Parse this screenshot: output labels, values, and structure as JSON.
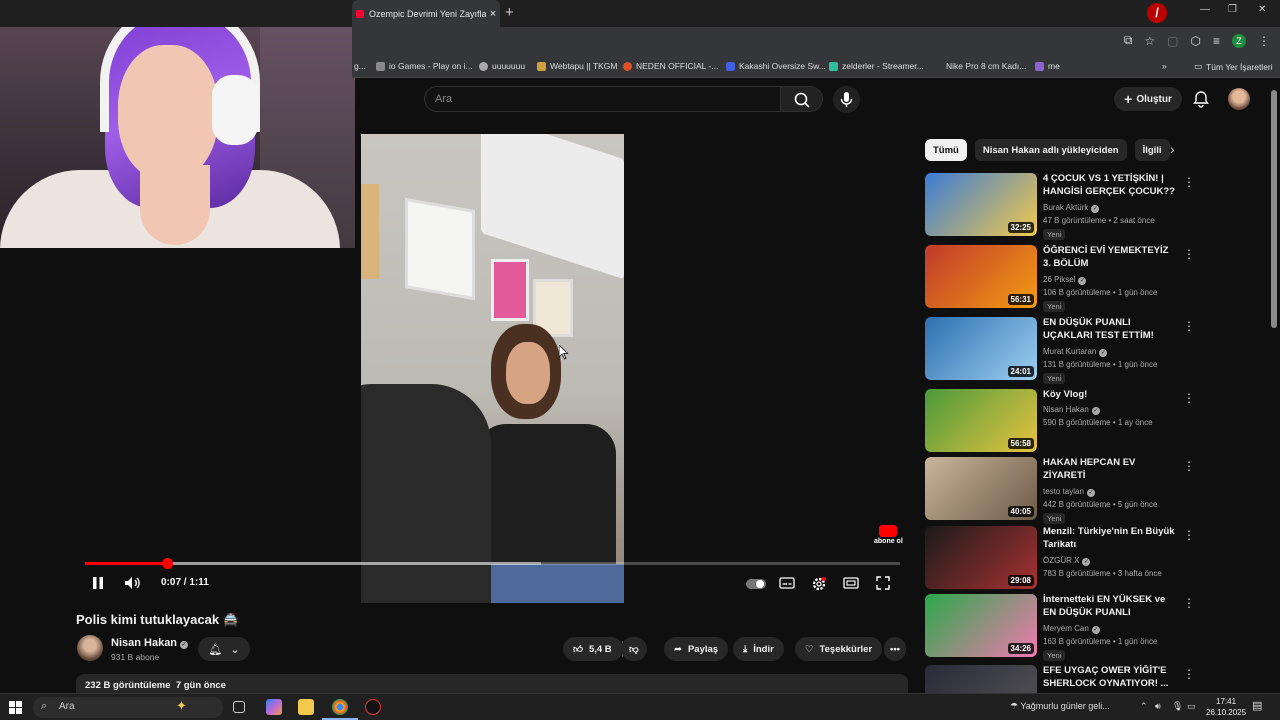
{
  "browser": {
    "tab_title": "Ozempic Devrimi Yeni Zayıflam",
    "tab_close": "×",
    "new_tab": "+",
    "bookmarks": [
      {
        "label": "g...",
        "color": ""
      },
      {
        "label": "io Games - Play on i...",
        "color": "#888888"
      },
      {
        "label": "uuuuuuu",
        "color": "#aaaaaa"
      },
      {
        "label": "Webtapu || TKGM",
        "color": "#d0a040"
      },
      {
        "label": "NEDEN OFFICIAL -...",
        "color": "#e05020"
      },
      {
        "label": "Kakashi Oversize Sw...",
        "color": "#4060e0"
      },
      {
        "label": "zelderler - Streamer...",
        "color": "#30c0a0"
      },
      {
        "label": "Nike Pro 8 cm Kadı...",
        "color": ""
      },
      {
        "label": "me",
        "color": "#9060d0"
      }
    ],
    "all_bookmarks": "Tüm Yer İşaretleri",
    "profile_initial": "Z"
  },
  "youtube": {
    "search_placeholder": "Ara",
    "create_label": "Oluştur",
    "player": {
      "current_time": "0:07 / 1:11",
      "progress": 0.1,
      "buffered": 0.56,
      "subscribe_overlay": "abone ol"
    },
    "video": {
      "title": "Polis kimi tutuklayacak 🚔",
      "channel": "Nisan Hakan",
      "subscribers": "931 B abone",
      "likes": "5,4 B",
      "share": "Paylaş",
      "download": "İndir",
      "thanks": "Teşekkürler",
      "views": "232 B görüntüleme",
      "date": "7 gün önce"
    },
    "chips": [
      "Tümü",
      "Nisan Hakan adlı yükleyiciden",
      "İlgili"
    ],
    "recommendations": [
      {
        "title": "4 ÇOCUK VS 1 YETİŞKİN! | HANGİSİ GERÇEK ÇOCUK?? ...",
        "channel": "Burak Aktürk",
        "meta": "47 B görüntüleme • 2 saat önce",
        "badge": "Yeni",
        "duration": "32:25",
        "thumb": [
          "#3a7bd5",
          "#f2c94c"
        ]
      },
      {
        "title": "ÖĞRENCİ EVİ YEMEKTEYİZ 3. BÖLÜM",
        "channel": "26 Piksel",
        "meta": "106 B görüntüleme • 1 gün önce",
        "badge": "Yeni",
        "duration": "56:31",
        "thumb": [
          "#c0392b",
          "#f39c12"
        ]
      },
      {
        "title": "EN DÜŞÜK PUANLI UÇAKLARI TEST ETTİM!",
        "channel": "Murat Kurtaran",
        "meta": "131 B görüntüleme • 1 gün önce",
        "badge": "Yeni",
        "duration": "24:01",
        "thumb": [
          "#2c6fb0",
          "#9ed0f0"
        ]
      },
      {
        "title": "Köy Vlog!",
        "channel": "Nisan Hakan",
        "meta": "590 B görüntüleme • 1 ay önce",
        "badge": "",
        "duration": "56:58",
        "thumb": [
          "#4a9a3a",
          "#e8c340"
        ]
      },
      {
        "title": "HAKAN HEPCAN EV ZİYARETİ",
        "channel": "testo taylan",
        "meta": "442 B görüntüleme • 5 gün önce",
        "badge": "Yeni",
        "duration": "40:05",
        "thumb": [
          "#c9b59a",
          "#6e5b48"
        ]
      },
      {
        "title": "Menzil: Türkiye'nin En Büyük Tarikatı",
        "channel": "ÖZGÜR X",
        "meta": "783 B görüntüleme • 3 hafta önce",
        "badge": "",
        "duration": "29:08",
        "thumb": [
          "#1a1a1a",
          "#a83232"
        ]
      },
      {
        "title": "İnternetteki EN YÜKSEK ve EN DÜŞÜK PUANLI Kostümleri ...",
        "channel": "Meryem Can",
        "meta": "163 B görüntüleme • 1 gün önce",
        "badge": "Yeni",
        "duration": "34:26",
        "thumb": [
          "#2aa84a",
          "#f07ab0"
        ]
      },
      {
        "title": "EFE UYGAÇ OWER YİĞİT'E SHERLOCK OYNATIYOR! ...",
        "channel": "",
        "meta": "",
        "badge": "",
        "duration": "",
        "thumb": [
          "#2a2a3a",
          "#555555"
        ]
      }
    ]
  },
  "taskbar": {
    "search_placeholder": "Ara",
    "weather": "Yağmurlu günler geli...",
    "time": "17:41",
    "date": "26.10.2025"
  }
}
